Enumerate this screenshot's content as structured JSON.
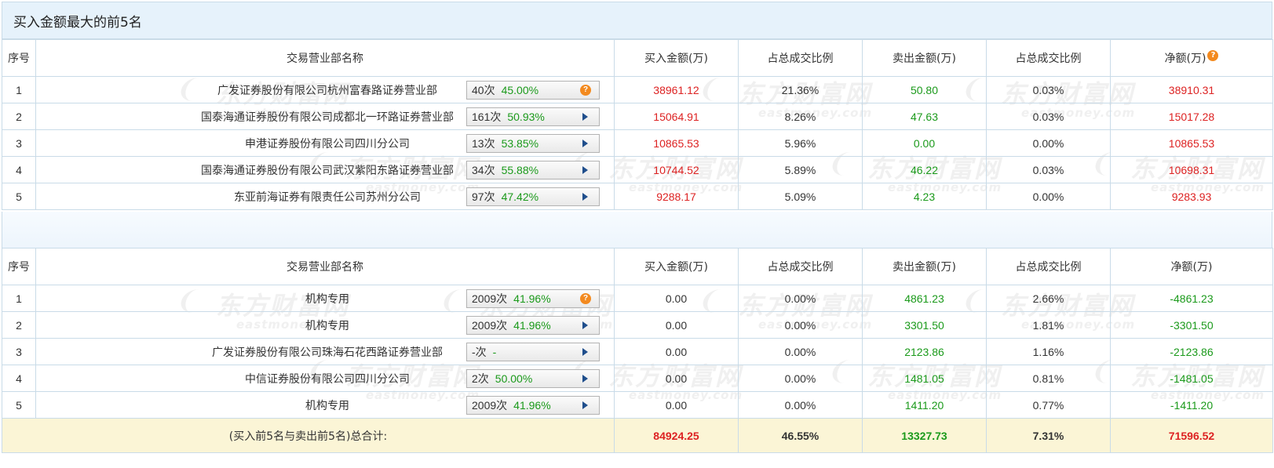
{
  "title": "买入金额最大的前5名",
  "watermark": {
    "cn": "东方财富网",
    "en": "eastmoney.com"
  },
  "colors": {
    "positive": "#dd2222",
    "negative": "#1b9a1b",
    "border": "#c9dbe8",
    "header_bg": "#e6f2fb",
    "total_bg": "#fbf5d6"
  },
  "headers": {
    "seq": "序号",
    "name": "交易营业部名称",
    "buy": "买入金额(万)",
    "buy_ratio": "占总成交比例",
    "sell": "卖出金额(万)",
    "sell_ratio": "占总成交比例",
    "net": "净额(万)"
  },
  "buy_rows": [
    {
      "seq": "1",
      "name": "广发证券股份有限公司杭州富春路证券营业部",
      "count": "40次",
      "pct": "45.00%",
      "icon": "question-icon",
      "buy": "38961.12",
      "buy_ratio": "21.36%",
      "sell": "50.80",
      "sell_ratio": "0.03%",
      "net": "38910.31"
    },
    {
      "seq": "2",
      "name": "国泰海通证券股份有限公司成都北一环路证券营业部",
      "count": "161次",
      "pct": "50.93%",
      "icon": "arrow-right-icon",
      "buy": "15064.91",
      "buy_ratio": "8.26%",
      "sell": "47.63",
      "sell_ratio": "0.03%",
      "net": "15017.28"
    },
    {
      "seq": "3",
      "name": "申港证券股份有限公司四川分公司",
      "count": "13次",
      "pct": "53.85%",
      "icon": "arrow-right-icon",
      "buy": "10865.53",
      "buy_ratio": "5.96%",
      "sell": "0.00",
      "sell_ratio": "0.00%",
      "net": "10865.53"
    },
    {
      "seq": "4",
      "name": "国泰海通证券股份有限公司武汉紫阳东路证券营业部",
      "count": "34次",
      "pct": "55.88%",
      "icon": "arrow-right-icon",
      "buy": "10744.52",
      "buy_ratio": "5.89%",
      "sell": "46.22",
      "sell_ratio": "0.03%",
      "net": "10698.31"
    },
    {
      "seq": "5",
      "name": "东亚前海证券有限责任公司苏州分公司",
      "count": "97次",
      "pct": "47.42%",
      "icon": "arrow-right-icon",
      "buy": "9288.17",
      "buy_ratio": "5.09%",
      "sell": "4.23",
      "sell_ratio": "0.00%",
      "net": "9283.93"
    }
  ],
  "sell_rows": [
    {
      "seq": "1",
      "name": "机构专用",
      "count": "2009次",
      "pct": "41.96%",
      "icon": "question-icon",
      "buy": "0.00",
      "buy_ratio": "0.00%",
      "sell": "4861.23",
      "sell_ratio": "2.66%",
      "net": "-4861.23"
    },
    {
      "seq": "2",
      "name": "机构专用",
      "count": "2009次",
      "pct": "41.96%",
      "icon": "arrow-right-icon",
      "buy": "0.00",
      "buy_ratio": "0.00%",
      "sell": "3301.50",
      "sell_ratio": "1.81%",
      "net": "-3301.50"
    },
    {
      "seq": "3",
      "name": "广发证券股份有限公司珠海石花西路证券营业部",
      "count": "-次",
      "pct": "-",
      "icon": "arrow-right-icon",
      "buy": "0.00",
      "buy_ratio": "0.00%",
      "sell": "2123.86",
      "sell_ratio": "1.16%",
      "net": "-2123.86"
    },
    {
      "seq": "4",
      "name": "中信证券股份有限公司四川分公司",
      "count": "2次",
      "pct": "50.00%",
      "icon": "arrow-right-icon",
      "buy": "0.00",
      "buy_ratio": "0.00%",
      "sell": "1481.05",
      "sell_ratio": "0.81%",
      "net": "-1481.05"
    },
    {
      "seq": "5",
      "name": "机构专用",
      "count": "2009次",
      "pct": "41.96%",
      "icon": "arrow-right-icon",
      "buy": "0.00",
      "buy_ratio": "0.00%",
      "sell": "1411.20",
      "sell_ratio": "0.77%",
      "net": "-1411.20"
    }
  ],
  "total": {
    "label": "(买入前5名与卖出前5名)总合计:",
    "buy": "84924.25",
    "buy_ratio": "46.55%",
    "sell": "13327.73",
    "sell_ratio": "7.31%",
    "net": "71596.52"
  }
}
